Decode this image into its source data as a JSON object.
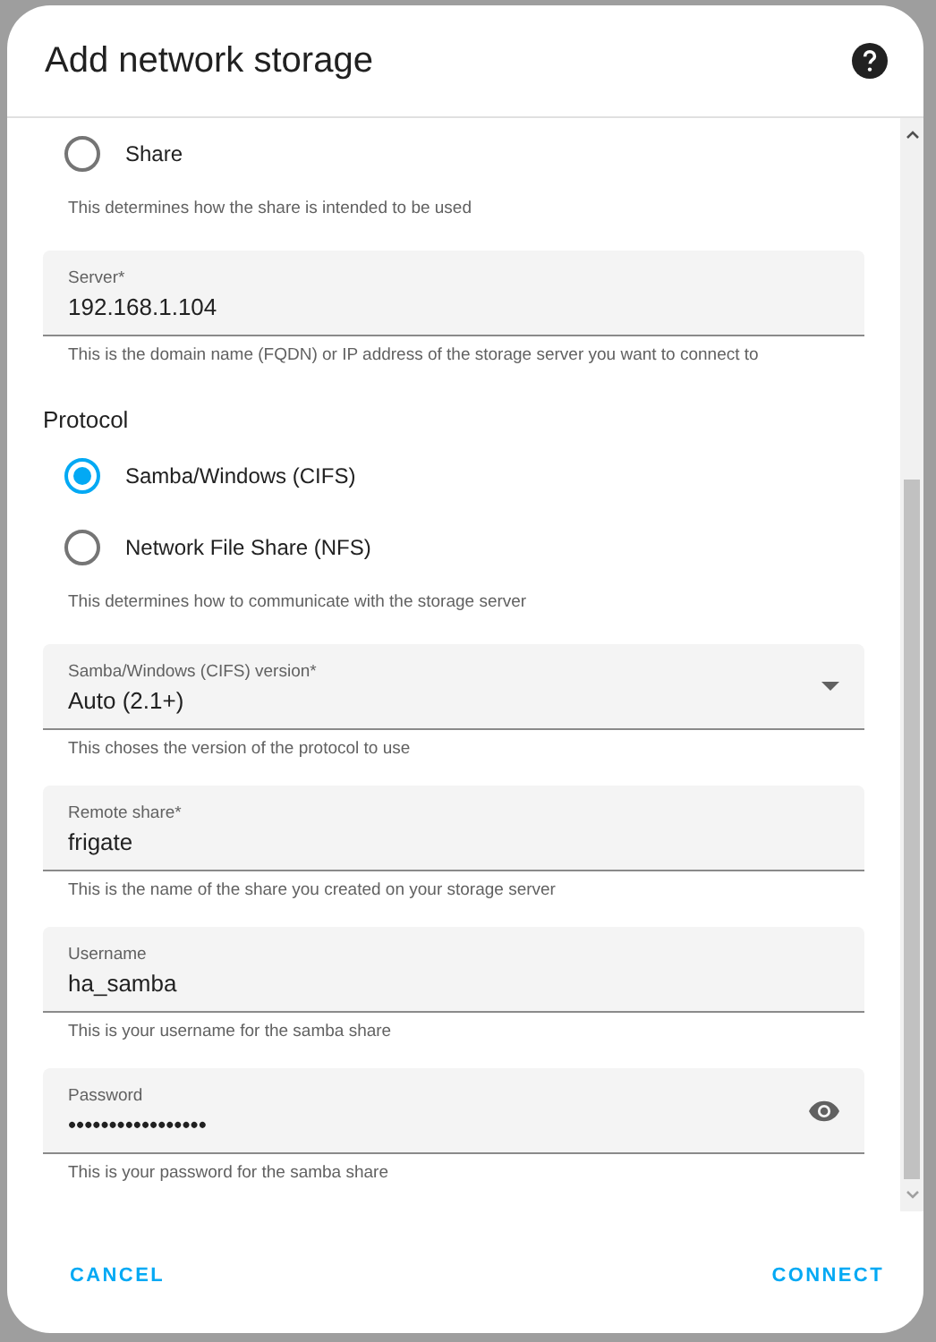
{
  "dialog": {
    "title": "Add network storage"
  },
  "usage": {
    "options": [
      {
        "label": "Share",
        "selected": false
      }
    ],
    "hint": "This determines how the share is intended to be used"
  },
  "server": {
    "label": "Server*",
    "value": "192.168.1.104",
    "hint": "This is the domain name (FQDN) or IP address of the storage server you want to connect to"
  },
  "protocol": {
    "heading": "Protocol",
    "options": [
      {
        "label": "Samba/Windows (CIFS)",
        "selected": true
      },
      {
        "label": "Network File Share (NFS)",
        "selected": false
      }
    ],
    "hint": "This determines how to communicate with the storage server"
  },
  "fields": [
    {
      "kind": "select",
      "label": "Samba/Windows (CIFS) version*",
      "value": "Auto (2.1+)",
      "hint": "This choses the version of the protocol to use"
    },
    {
      "kind": "text",
      "label": "Remote share*",
      "value": "frigate",
      "hint": "This is the name of the share you created on your storage server"
    },
    {
      "kind": "text",
      "label": "Username",
      "value": "ha_samba",
      "hint": "This is your username for the samba share"
    },
    {
      "kind": "password",
      "label": "Password",
      "value": "•••••••••••••••••",
      "hint": "This is your password for the samba share"
    }
  ],
  "buttons": [
    "CANCEL",
    "CONNECT"
  ]
}
